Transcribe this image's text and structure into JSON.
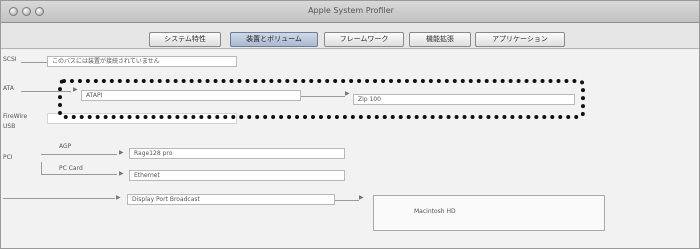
{
  "window": {
    "title": "Apple System Profiler"
  },
  "tabs": [
    {
      "label": "システム特性",
      "selected": false
    },
    {
      "label": "装置とボリューム",
      "selected": true
    },
    {
      "label": "フレームワーク",
      "selected": false
    },
    {
      "label": "機能拡張",
      "selected": false
    },
    {
      "label": "アプリケーション",
      "selected": false
    }
  ],
  "rows": {
    "row1_label": "SCSI",
    "row1_value": "このバスには装置が接続されていません",
    "row2_label": "ATA",
    "row2_node1": "ATAPI",
    "row2_node2": "Zip 100",
    "row3_label": "FireWire",
    "row4_label": "USB",
    "row5_label": "PCI",
    "row5_sub1": "AGP",
    "row5_sub2": "PC Card",
    "row5_node1": "Rage128 pro",
    "row5_node2": "Ethernet",
    "row6_node": "Display Port Broadcast",
    "row6_result": "Macintosh HD"
  },
  "colors": {
    "highlight": "#111111",
    "selected_tab": "#a9b9cf"
  }
}
